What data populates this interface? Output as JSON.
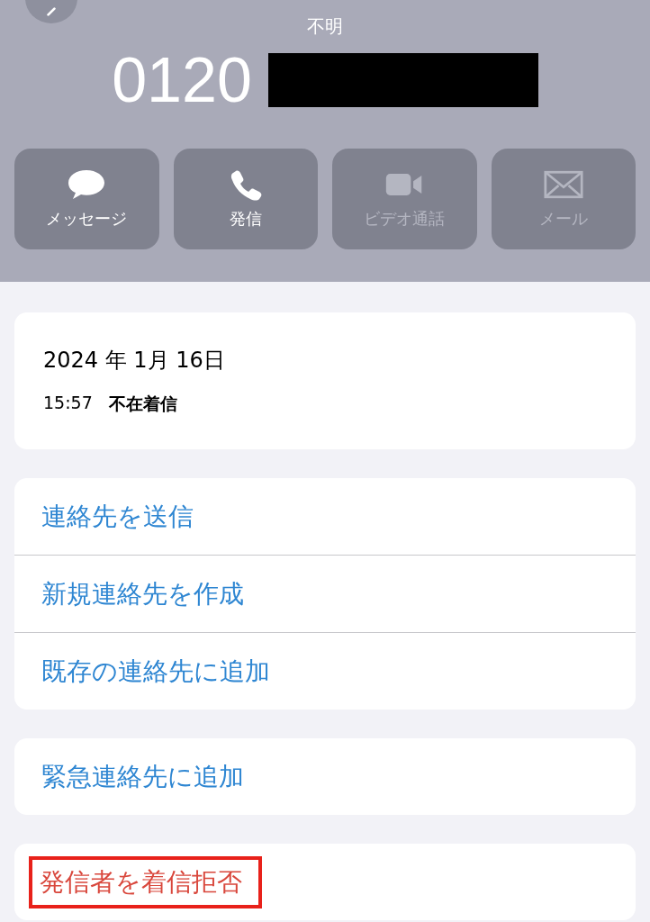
{
  "header": {
    "caller_label": "不明",
    "number": "0120",
    "number_redacted": true
  },
  "actions": [
    {
      "label": "メッセージ",
      "kind": "message",
      "disabled": false
    },
    {
      "label": "発信",
      "kind": "call",
      "disabled": false
    },
    {
      "label": "ビデオ通話",
      "kind": "video",
      "disabled": true
    },
    {
      "label": "メール",
      "kind": "mail",
      "disabled": true
    }
  ],
  "call_info": {
    "date": "2024 年 1月 16日",
    "time": "15:57",
    "type": "不在着信"
  },
  "sections": [
    [
      {
        "label": "連絡先を送信",
        "kind": "normal",
        "highlighted": false
      },
      {
        "label": "新規連絡先を作成",
        "kind": "normal",
        "highlighted": false
      },
      {
        "label": "既存の連絡先に追加",
        "kind": "normal",
        "highlighted": false
      }
    ],
    [
      {
        "label": "緊急連絡先に追加",
        "kind": "normal",
        "highlighted": false
      }
    ],
    [
      {
        "label": "発信者を着信拒否",
        "kind": "destructive",
        "highlighted": true
      }
    ]
  ]
}
